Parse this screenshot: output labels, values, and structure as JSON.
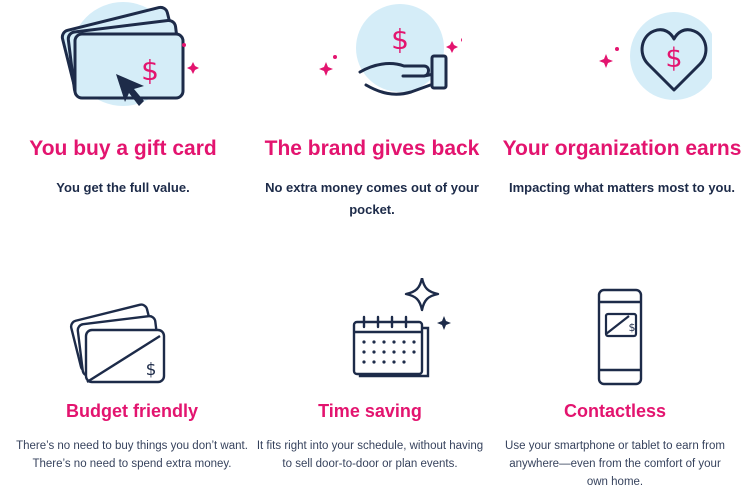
{
  "colors": {
    "accent": "#e3146f",
    "navy": "#1d2b49",
    "circle": "#d5edf8"
  },
  "benefits": [
    {
      "icon": "gift-card-cursor-icon",
      "title": "You buy a gift card",
      "subtitle": "You get the full value."
    },
    {
      "icon": "hand-giving-icon",
      "title": "The brand gives back",
      "subtitle": "No extra money comes out of your pocket."
    },
    {
      "icon": "heart-dollar-icon",
      "title": "Your organization earns",
      "subtitle": "Impacting what matters most to you."
    }
  ],
  "features": [
    {
      "icon": "gift-cards-stack-icon",
      "title": "Budget friendly",
      "description": "There’s no need to buy things you don’t want. There’s no need to spend extra money."
    },
    {
      "icon": "calendar-icon",
      "title": "Time saving",
      "description": "It fits right into your schedule, without having to sell door-to-door or plan events."
    },
    {
      "icon": "smartphone-card-icon",
      "title": "Contactless",
      "description": "Use your smartphone or tablet to earn from anywhere—even from the comfort of your own home."
    }
  ]
}
